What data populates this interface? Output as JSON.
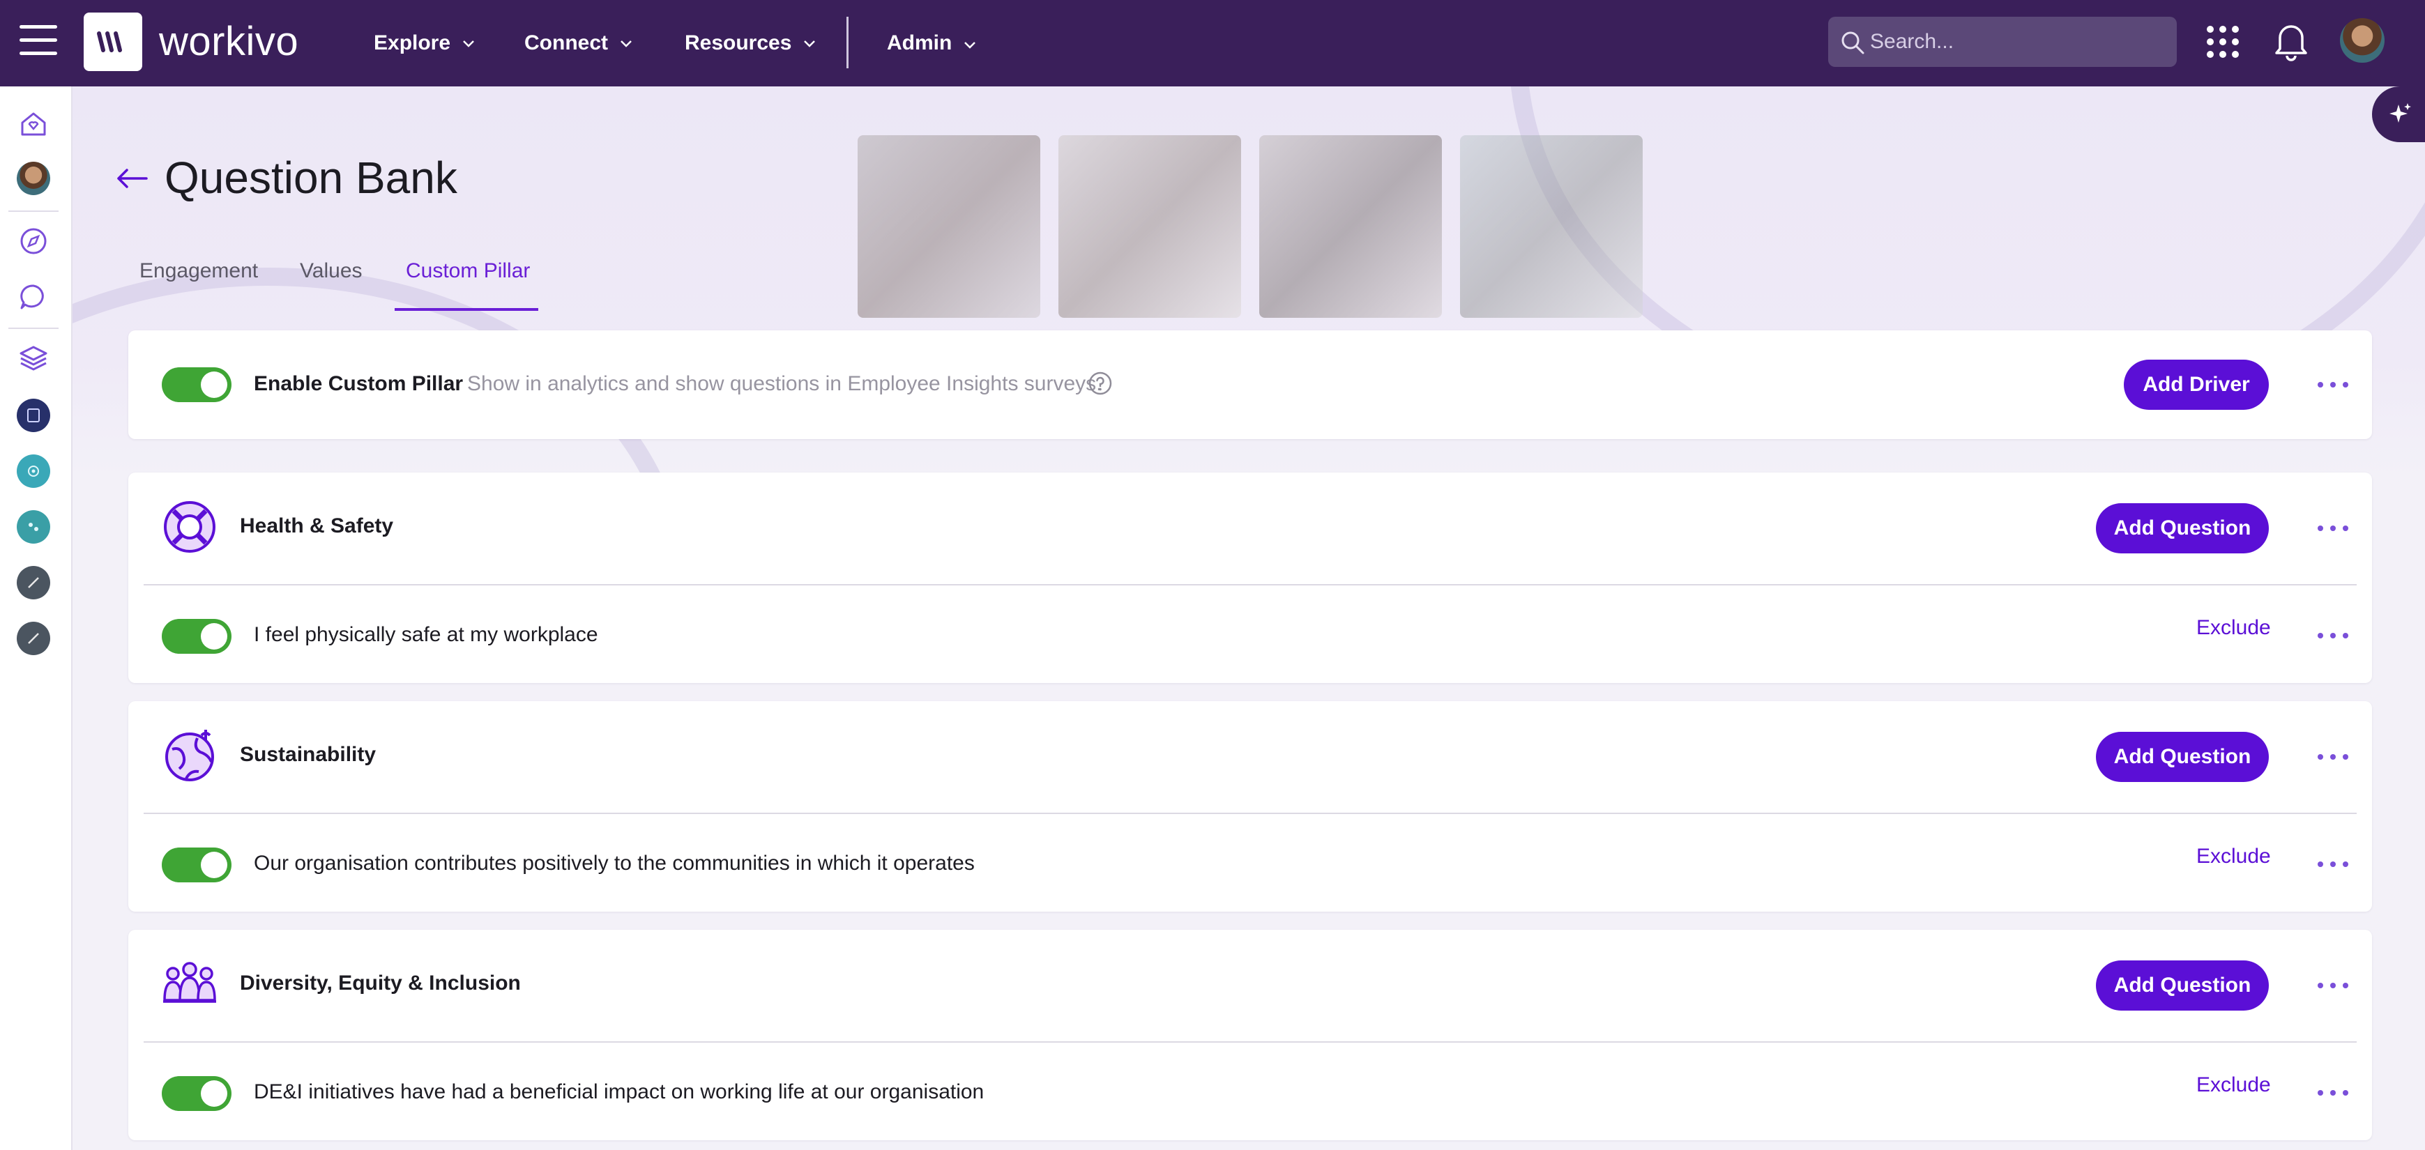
{
  "app": {
    "name": "workivo"
  },
  "nav": {
    "items": [
      {
        "label": "Explore"
      },
      {
        "label": "Connect"
      },
      {
        "label": "Resources"
      },
      {
        "label": "Admin"
      }
    ],
    "search_placeholder": "Search..."
  },
  "page": {
    "title": "Question Bank",
    "tabs": [
      {
        "label": "Engagement",
        "active": false
      },
      {
        "label": "Values",
        "active": false
      },
      {
        "label": "Custom Pillar",
        "active": true
      }
    ]
  },
  "pillar": {
    "enable_label": "Enable Custom Pillar",
    "enable_desc": "Show in analytics and show questions in Employee Insights surveys.",
    "enabled": true,
    "add_driver_label": "Add Driver"
  },
  "drivers": [
    {
      "title": "Health & Safety",
      "icon": "lifebuoy-icon",
      "add_question_label": "Add Question",
      "question": "I feel physically safe at my workplace",
      "question_enabled": true,
      "exclude_label": "Exclude"
    },
    {
      "title": "Sustainability",
      "icon": "globe-icon",
      "add_question_label": "Add Question",
      "question": "Our organisation contributes positively to the communities in which it operates",
      "question_enabled": true,
      "exclude_label": "Exclude"
    },
    {
      "title": "Diversity, Equity & Inclusion",
      "icon": "people-icon",
      "add_question_label": "Add Question",
      "question": "DE&I initiatives have had a beneficial impact on working life at our organisation",
      "question_enabled": true,
      "exclude_label": "Exclude"
    }
  ],
  "colors": {
    "topbar": "#3a1f5a",
    "accent": "#5b0fd6",
    "toggle_on": "#3fa535"
  }
}
